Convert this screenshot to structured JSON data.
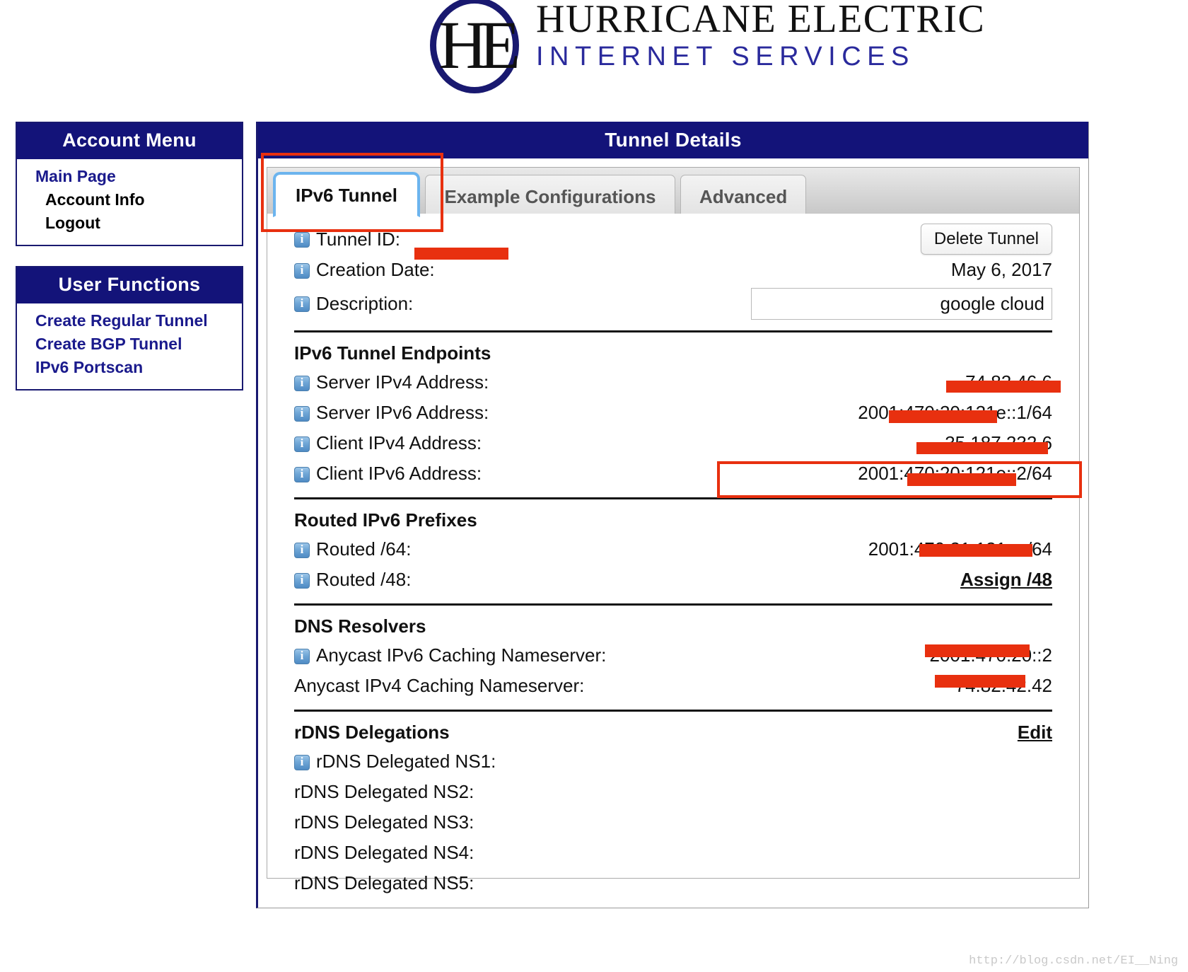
{
  "brand": {
    "monogram": "HE",
    "line1": "HURRICANE ELECTRIC",
    "line2": "INTERNET SERVICES",
    "navy": "#191970",
    "blue_text": "#2a2a9c"
  },
  "sidebar": {
    "panels": [
      {
        "title": "Account Menu",
        "items": [
          {
            "label": "Main Page",
            "style": "link"
          },
          {
            "label": "Account Info",
            "style": "sub"
          },
          {
            "label": "Logout",
            "style": "sub"
          }
        ]
      },
      {
        "title": "User Functions",
        "items": [
          {
            "label": "Create Regular Tunnel",
            "style": "link"
          },
          {
            "label": "Create BGP Tunnel",
            "style": "link"
          },
          {
            "label": "IPv6 Portscan",
            "style": "link"
          }
        ]
      }
    ]
  },
  "main": {
    "title": "Tunnel Details",
    "tabs": [
      {
        "label": "IPv6 Tunnel",
        "active": true
      },
      {
        "label": "Example Configurations",
        "active": false
      },
      {
        "label": "Advanced",
        "active": false
      }
    ],
    "tunnel": {
      "tunnel_id_label": "Tunnel ID:",
      "tunnel_id_value": "",
      "delete_button": "Delete Tunnel",
      "creation_date_label": "Creation Date:",
      "creation_date_value": "May 6, 2017",
      "description_label": "Description:",
      "description_value": "google cloud",
      "description_placeholder": ""
    },
    "endpoints": {
      "heading": "IPv6 Tunnel Endpoints",
      "rows": [
        {
          "label": "Server IPv4 Address:",
          "value": "74.82.46.6"
        },
        {
          "label": "Server IPv6 Address:",
          "value": "2001:470:20:121e::1/64"
        },
        {
          "label": "Client IPv4 Address:",
          "value": "35.187.232.6"
        },
        {
          "label": "Client IPv6 Address:",
          "value": "2001:470:20:121e::2/64"
        }
      ]
    },
    "routed": {
      "heading": "Routed IPv6 Prefixes",
      "rows": [
        {
          "label": "Routed /64:",
          "value": "2001:470:21:121e::/64"
        },
        {
          "label": "Routed /48:",
          "value": "Assign /48",
          "is_link": true
        }
      ]
    },
    "dns": {
      "heading": "DNS Resolvers",
      "rows": [
        {
          "label": "Anycast IPv6 Caching Nameserver:",
          "value": "2001:470:20::2",
          "has_icon": true
        },
        {
          "label": "Anycast IPv4 Caching Nameserver:",
          "value": "74.82.42.42",
          "has_icon": false
        }
      ]
    },
    "rdns": {
      "heading": "rDNS Delegations",
      "edit_label": "Edit",
      "rows": [
        {
          "label": "rDNS Delegated NS1:",
          "value": "",
          "has_icon": true
        },
        {
          "label": "rDNS Delegated NS2:",
          "value": "",
          "has_icon": false
        },
        {
          "label": "rDNS Delegated NS3:",
          "value": "",
          "has_icon": false
        },
        {
          "label": "rDNS Delegated NS4:",
          "value": "",
          "has_icon": false
        },
        {
          "label": "rDNS Delegated NS5:",
          "value": "",
          "has_icon": false
        }
      ]
    }
  },
  "annotations": {
    "redaction_color": "#e8300f",
    "highlight_tab": "IPv6 Tunnel",
    "highlight_row": "Client IPv6 Address"
  },
  "watermark": "http://blog.csdn.net/EI__Ning"
}
